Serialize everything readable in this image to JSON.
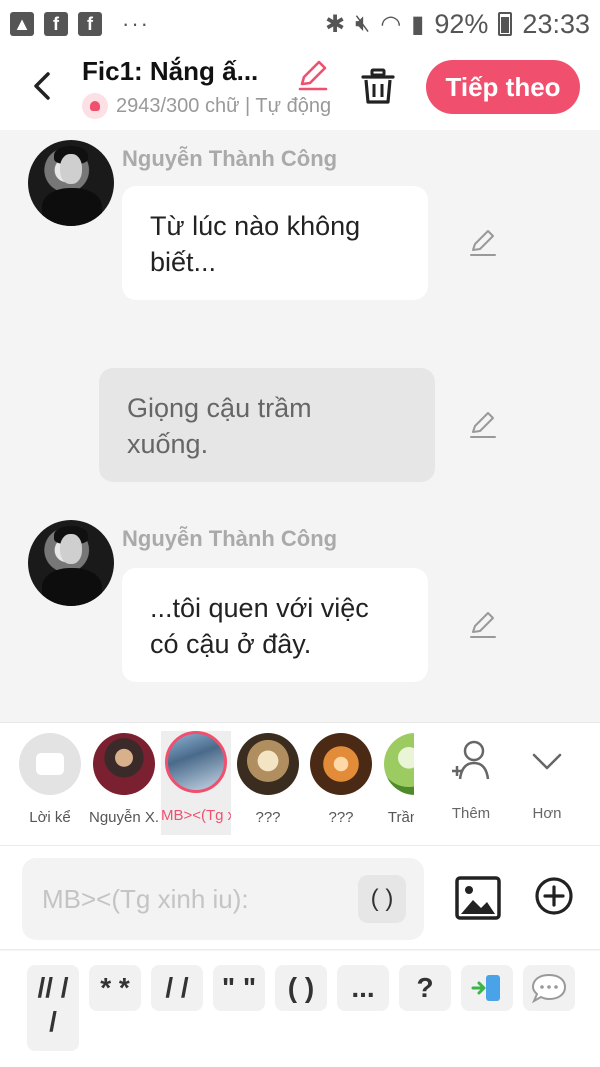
{
  "statusbar": {
    "battery": "92%",
    "time": "23:33"
  },
  "header": {
    "title": "Fic1: Nắng ấ...",
    "subtitle": "2943/300 chữ | Tự động",
    "next_label": "Tiếp theo"
  },
  "messages": [
    {
      "type": "character",
      "name": "Nguyễn Thành Công",
      "text_line1": "Từ lúc nào không",
      "text_line2": "biết..."
    },
    {
      "type": "narration",
      "text_line1": "Giọng cậu trầm",
      "text_line2": "xuống."
    },
    {
      "type": "character",
      "name": "Nguyễn Thành Công",
      "text_line1": "...tôi quen với việc",
      "text_line2": "có cậu ở đây."
    }
  ],
  "characters": [
    {
      "label": "Lời kể"
    },
    {
      "label": "Nguyễn X..."
    },
    {
      "label": "MB><(Tg x...",
      "selected": true
    },
    {
      "label": "???"
    },
    {
      "label": "???"
    },
    {
      "label": "Trần T..."
    }
  ],
  "char_actions": {
    "add_label": "Thêm",
    "more_label": "Hơn"
  },
  "input": {
    "placeholder": "MB><(Tg xinh iu):",
    "paren_chip": "( )"
  },
  "quick_chips": [
    "// /\n/",
    "* *",
    "/ /",
    "\" \"",
    "( )",
    "...",
    "?"
  ],
  "colors": {
    "accent": "#f0506e",
    "background": "#f4f4f4"
  }
}
